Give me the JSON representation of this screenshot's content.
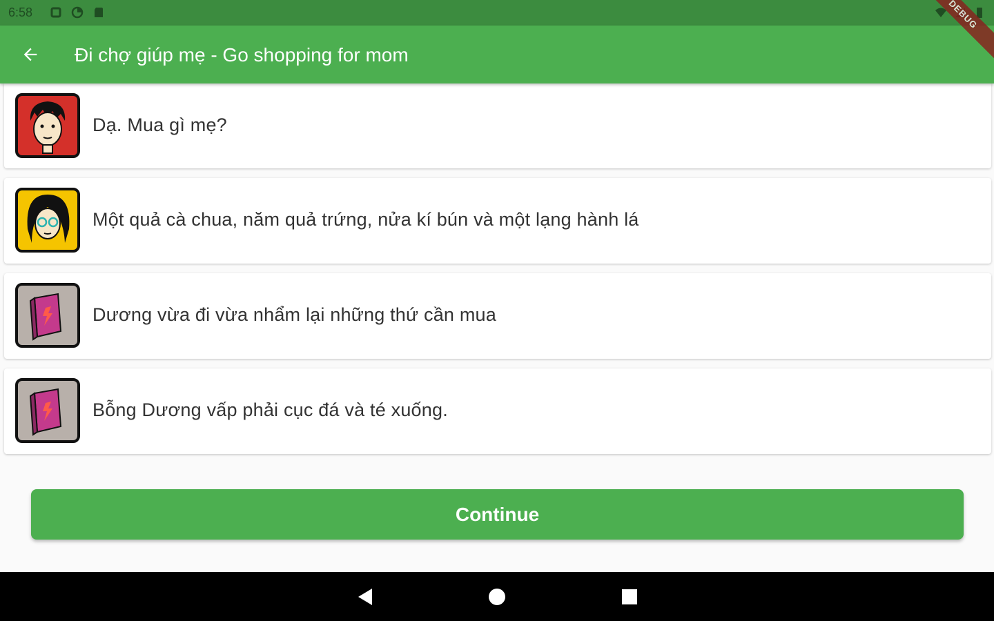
{
  "status_bar": {
    "time": "6:58",
    "icons": [
      "notification-icon",
      "sync-icon",
      "sd-card-icon"
    ],
    "right_icons": [
      "wifi-icon",
      "signal-icon",
      "battery-icon"
    ]
  },
  "debug_banner": "DEBUG",
  "app_bar": {
    "title": "Đi chợ giúp mẹ - Go shopping for mom",
    "back_icon": "arrow-back-icon",
    "color": "#4caf50"
  },
  "dialogue": [
    {
      "speaker": "boy-avatar",
      "avatar_bg": "#d4302a",
      "text": "Dạ. Mua gì mẹ?"
    },
    {
      "speaker": "mother-avatar",
      "avatar_bg": "#f5c400",
      "text": "Một quả cà chua, năm quả trứng, nửa kí bún và một lạng hành lá"
    },
    {
      "speaker": "narrator-book-avatar",
      "avatar_bg": "#b8b0aa",
      "text": "Dương vừa đi vừa nhẩm lại những thứ cần mua"
    },
    {
      "speaker": "narrator-book-avatar",
      "avatar_bg": "#b8b0aa",
      "text": "Bỗng Dương vấp phải cục đá và té xuống."
    }
  ],
  "continue_button": {
    "label": "Continue"
  },
  "nav_bar": {
    "icons": [
      "back-triangle-icon",
      "home-circle-icon",
      "recents-square-icon"
    ]
  }
}
